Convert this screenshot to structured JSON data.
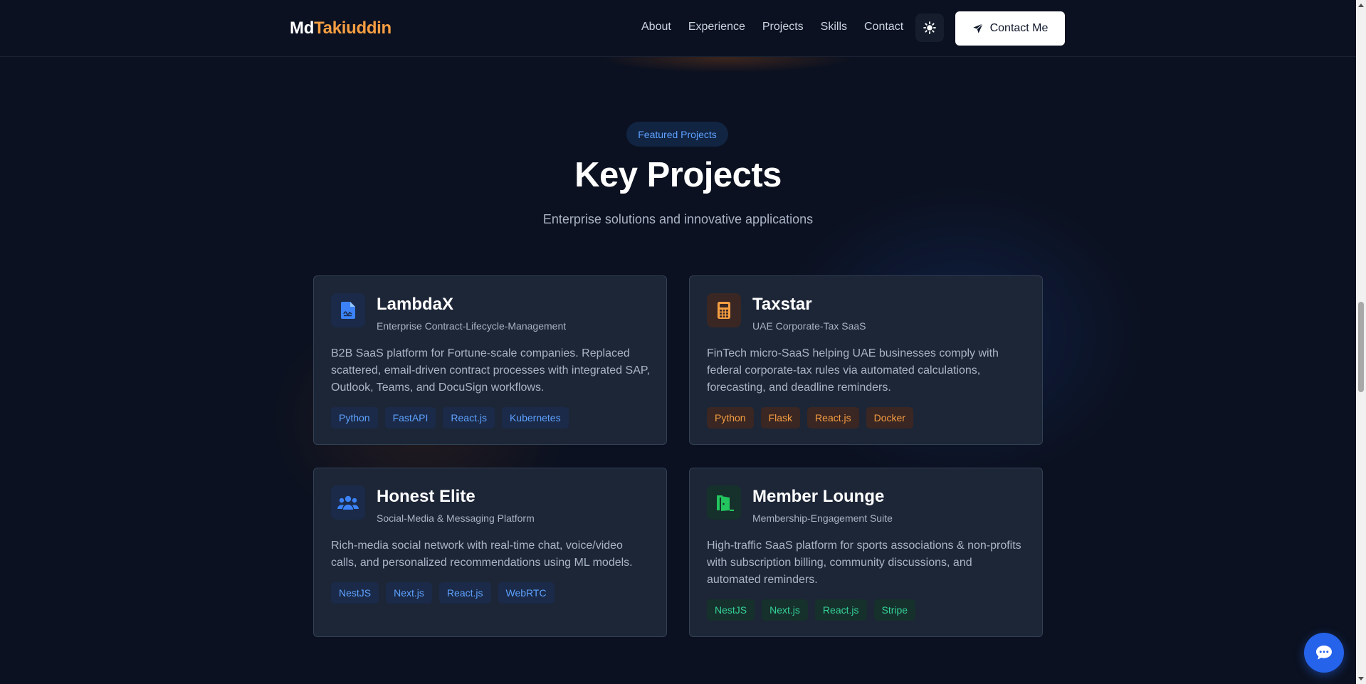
{
  "brand": {
    "first": "Md",
    "last": "Takiuddin"
  },
  "nav": {
    "items": [
      {
        "label": "About"
      },
      {
        "label": "Experience"
      },
      {
        "label": "Projects"
      },
      {
        "label": "Skills"
      },
      {
        "label": "Contact"
      }
    ],
    "theme_icon": "sun-icon",
    "contact_label": "Contact Me",
    "contact_icon": "paper-plane-icon"
  },
  "section": {
    "badge": "Featured Projects",
    "title": "Key Projects",
    "subtitle": "Enterprise solutions and innovative applications"
  },
  "projects": [
    {
      "name": "LambdaX",
      "tagline": "Enterprise Contract-Lifecycle-Management",
      "description": "B2B SaaS platform for Fortune-scale companies. Replaced scattered, email-driven contract processes with integrated SAP, Outlook, Teams, and DocuSign workflows.",
      "icon": "contract-document-icon",
      "accent": "#3b82f6",
      "tags": [
        "Python",
        "FastAPI",
        "React.js",
        "Kubernetes"
      ]
    },
    {
      "name": "Taxstar",
      "tagline": "UAE Corporate-Tax SaaS",
      "description": "FinTech micro-SaaS helping UAE businesses comply with federal corporate-tax rules via automated calculations, forecasting, and deadline reminders.",
      "icon": "calculator-icon",
      "accent": "#f59e42",
      "tags": [
        "Python",
        "Flask",
        "React.js",
        "Docker"
      ]
    },
    {
      "name": "Honest Elite",
      "tagline": "Social-Media & Messaging Platform",
      "description": "Rich-media social network with real-time chat, voice/video calls, and personalized recommendations using ML models.",
      "icon": "users-icon",
      "accent": "#3b82f6",
      "tags": [
        "NestJS",
        "Next.js",
        "React.js",
        "WebRTC"
      ]
    },
    {
      "name": "Member Lounge",
      "tagline": "Membership-Engagement Suite",
      "description": "High-traffic SaaS platform for sports associations & non-profits with subscription billing, community discussions, and automated reminders.",
      "icon": "door-open-icon",
      "accent": "#22c55e",
      "tags": [
        "NestJS",
        "Next.js",
        "React.js",
        "Stripe"
      ]
    }
  ],
  "chat": {
    "icon": "chat-bubble-icon"
  }
}
